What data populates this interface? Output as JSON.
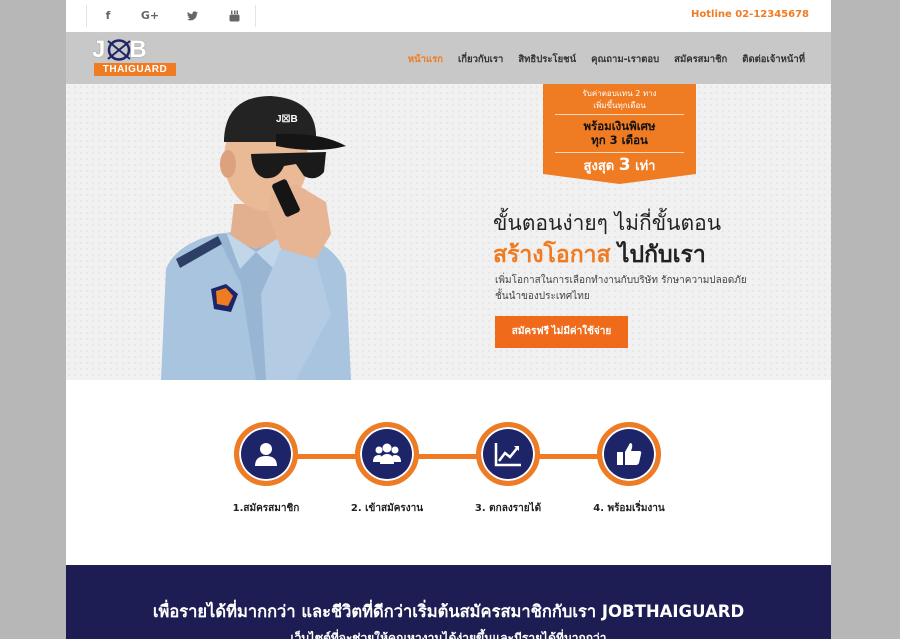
{
  "social": {
    "facebook": "f",
    "googleplus": "G+",
    "twitter": "🐦",
    "youtube": "▶"
  },
  "hotline": "Hotline 02-12345678",
  "logo": {
    "top": "JOB",
    "bottom": "THAIGUARD"
  },
  "nav": {
    "items": [
      {
        "label": "หน้าแรก",
        "active": true
      },
      {
        "label": "เกี่ยวกับเรา",
        "active": false
      },
      {
        "label": "สิทธิประโยชน์",
        "active": false
      },
      {
        "label": "คุณถาม-เราตอบ",
        "active": false
      },
      {
        "label": "สมัครสมาชิก",
        "active": false
      },
      {
        "label": "ติดต่อเจ้าหน้าที่",
        "active": false
      }
    ]
  },
  "promo": {
    "line1": "รับค่าตอบแทน 2 ทาง",
    "line2": "เพิ่มขึ้นทุกเดือน",
    "line3": "พร้อมเงินพิเศษ",
    "line4": "ทุก 3 เดือน",
    "line5_prefix": "สูงสุด",
    "line5_number": "3",
    "line5_suffix": "เท่า",
    "color": "#ef7b22"
  },
  "hero": {
    "headline1": "ขั้นตอนง่ายๆ ไม่กี่ขั้นตอน",
    "headline2_orange": "สร้างโอกาส",
    "headline2_dark": "ไปกับเรา",
    "desc1": "เพิ่มโอกาสในการเลือกทำงานกับบริษัท รักษาความปลอดภัย",
    "desc2": "ชั้นนำของประเทศไทย",
    "cta": "สมัครฟรี ไม่มีค่าใช้จ่าย"
  },
  "steps": [
    {
      "label": "1.สมัครสมาชิก",
      "icon": "user-icon"
    },
    {
      "label": "2. เข้าสมัครงาน",
      "icon": "group-icon"
    },
    {
      "label": "3. ตกลงรายได้",
      "icon": "chart-icon"
    },
    {
      "label": "4. พร้อมเริ่มงาน",
      "icon": "thumbs-up-icon"
    }
  ],
  "banner": {
    "title": "เพื่อรายได้ที่มากกว่า และชีวิตที่ดีกว่าเริ่มต้นสมัครสมาชิกกับเรา JOBTHAIGUARD",
    "subtitle": "เว็บไซต์ที่จะช่วยให้คุณหางานได้ง่ายขึ้นและมีรายได้ที่มากกว่า"
  },
  "colors": {
    "accent": "#ef7b22",
    "navy": "#1d2568",
    "banner": "#1d1d54"
  }
}
